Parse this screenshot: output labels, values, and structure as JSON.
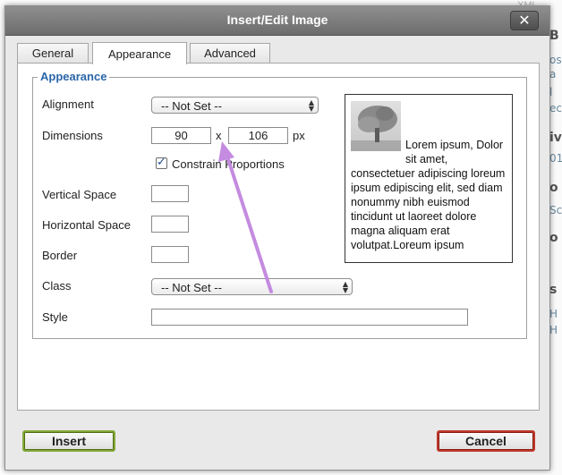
{
  "background": {
    "top_text": "XML",
    "fragments": [
      "B",
      "os",
      "a",
      "l",
      "ec",
      "iv",
      "01",
      "o",
      "Sc",
      "o",
      "s",
      "H",
      "H"
    ]
  },
  "dialog": {
    "title": "Insert/Edit Image",
    "close_glyph": "✕"
  },
  "tabs": [
    {
      "label": "General",
      "active": false
    },
    {
      "label": "Appearance",
      "active": true
    },
    {
      "label": "Advanced",
      "active": false
    }
  ],
  "appearance": {
    "legend": "Appearance",
    "alignment": {
      "label": "Alignment",
      "value": "-- Not Set --"
    },
    "dimensions": {
      "label": "Dimensions",
      "width": "90",
      "height": "106",
      "separator": "x",
      "unit": "px"
    },
    "constrain": {
      "label": "Constrain Proportions",
      "checked": true
    },
    "vertical_space": {
      "label": "Vertical Space",
      "value": ""
    },
    "horizontal_space": {
      "label": "Horizontal Space",
      "value": ""
    },
    "border": {
      "label": "Border",
      "value": ""
    },
    "class": {
      "label": "Class",
      "value": "-- Not Set --"
    },
    "style": {
      "label": "Style",
      "value": ""
    }
  },
  "preview": {
    "text": "Lorem ipsum, Dolor sit amet, consectetuer adipiscing loreum ipsum edipiscing elit, sed diam nonummy nibh euismod tincidunt ut laoreet dolore magna aliquam erat volutpat.Loreum ipsum"
  },
  "buttons": {
    "insert": "Insert",
    "cancel": "Cancel"
  },
  "colors": {
    "legend": "#2b66a8",
    "insert_border": "#84a83b",
    "cancel_border": "#c0392b",
    "annotation_arrow": "#c48be0"
  }
}
